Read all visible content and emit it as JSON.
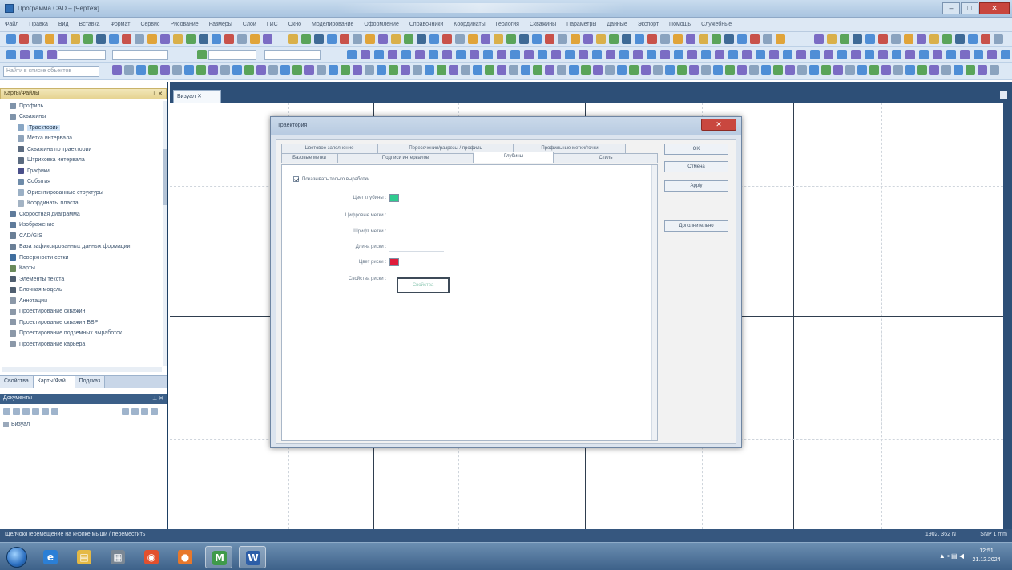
{
  "window": {
    "title": "Программа CAD – [Чертёж]"
  },
  "menu": [
    "Файл",
    "Правка",
    "Вид",
    "Вставка",
    "Формат",
    "Сервис",
    "Рисование",
    "Размеры",
    "Слои",
    "ГИС",
    "Окно",
    "Моделирование",
    "Оформление",
    "Справочники",
    "Координаты",
    "Геология",
    "Скважины",
    "Параметры",
    "Данные",
    "Экспорт",
    "Помощь",
    "Служебные"
  ],
  "toolbar": {
    "search_placeholder": "Найти в списке объектов"
  },
  "left_panel": {
    "header": "Карты/Файлы",
    "pin": "⊥ ✕",
    "items": [
      {
        "label": "Профиль",
        "indent": 0,
        "color": "#7f93aa"
      },
      {
        "label": "Скважины",
        "indent": 0,
        "color": "#7f93aa"
      },
      {
        "label": "Траектории",
        "indent": 1,
        "color": "#88a6c4",
        "selected": true
      },
      {
        "label": "Метка интервала",
        "indent": 1,
        "color": "#8fa4bb"
      },
      {
        "label": "Скважина по траектории",
        "indent": 1,
        "color": "#5b6b80"
      },
      {
        "label": "Штриховка интервала",
        "indent": 1,
        "color": "#5b6b80"
      },
      {
        "label": "Графики",
        "indent": 1,
        "color": "#4a4f8a"
      },
      {
        "label": "События",
        "indent": 1,
        "color": "#6e8ba9"
      },
      {
        "label": "Ориентированные структуры",
        "indent": 1,
        "color": "#9bb0c5"
      },
      {
        "label": "Координаты пласта",
        "indent": 1,
        "color": "#a3b3c4"
      },
      {
        "label": "Скоростная диаграмма",
        "indent": 0,
        "color": "#5f7b9b"
      },
      {
        "label": "Изображение",
        "indent": 0,
        "color": "#5f7b9b"
      },
      {
        "label": "CAD/GIS",
        "indent": 0,
        "color": "#6a7f96"
      },
      {
        "label": "База зафиксированных данных формации",
        "indent": 0,
        "color": "#6a7f96"
      },
      {
        "label": "Поверхности сетки",
        "indent": 0,
        "color": "#3f6e9e"
      },
      {
        "label": "Карты",
        "indent": 0,
        "color": "#6a8a5a"
      },
      {
        "label": "Элементы текста",
        "indent": 0,
        "color": "#4f5e70"
      },
      {
        "label": "Блочная модель",
        "indent": 0,
        "color": "#4f5e70"
      },
      {
        "label": "Аннотации",
        "indent": 0,
        "color": "#8b98a8"
      },
      {
        "label": "Проектирование скважин",
        "indent": 0,
        "color": "#8b98a8"
      },
      {
        "label": "Проектирование скважин БВР",
        "indent": 0,
        "color": "#8b98a8"
      },
      {
        "label": "Проектирование подземных выработок",
        "indent": 0,
        "color": "#8b98a8"
      },
      {
        "label": "Проектирование карьера",
        "indent": 0,
        "color": "#8b98a8"
      }
    ],
    "tabs": [
      "Свойства",
      "Карты/Фай...",
      "Подсказ"
    ],
    "second_header": "Документы",
    "second_pin": "⊥ ✕",
    "list_item": "Визуал"
  },
  "document": {
    "tab": "Визуал ✕"
  },
  "dialog": {
    "title": "Траектория",
    "close": "✕",
    "tabs_row1": [
      "Цветовое заполнение",
      "Пересечения/разрезы / профиль",
      "Профильные метки/точки"
    ],
    "tabs_row2": [
      "Базовые метки",
      "Подписи интервалов",
      "Глубины",
      "Стиль"
    ],
    "active_tab": "Глубины",
    "checkbox_label": "Показывать только выработки",
    "fields": [
      {
        "label": "Цвет глубины :",
        "swatch": "#2fcb8f"
      },
      {
        "label": "Цифровые метки :",
        "swatch": ""
      },
      {
        "label": "Шрифт метки :",
        "swatch": ""
      },
      {
        "label": "Длина риски :",
        "swatch": ""
      },
      {
        "label": "Цвет риски :",
        "swatch": "#e01b3a"
      },
      {
        "label": "Свойства риски :",
        "swatch": ""
      }
    ],
    "symbol_button": "Свойства",
    "buttons": [
      "OK",
      "Отмена",
      "Apply",
      "Дополнительно"
    ]
  },
  "statusbar": {
    "message": "Щелчок/Перемещение на кнопке мыши / переместить",
    "coords": "1902, 362 N",
    "mode": "SNP 1 mm"
  },
  "taskbar": {
    "apps": [
      "e",
      "▤",
      "▦",
      "◉",
      "●",
      "M",
      "W"
    ],
    "tray": "▲ ▪ ▤ ◀",
    "time": "12:51",
    "date": "21.12.2024"
  }
}
